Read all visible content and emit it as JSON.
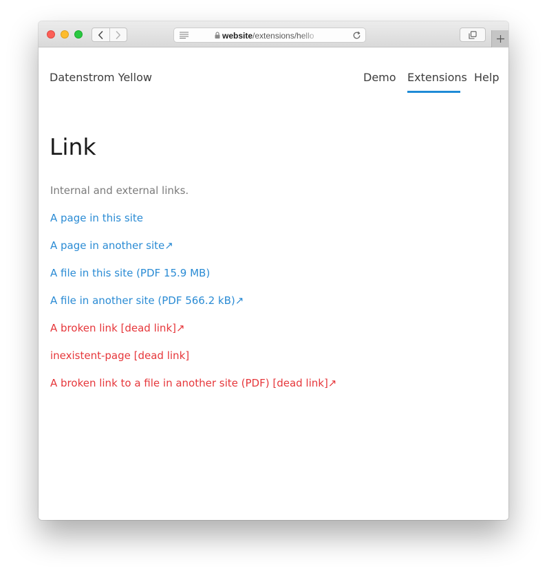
{
  "browser": {
    "url": {
      "host": "website",
      "path": "/extensions/hello"
    }
  },
  "site": {
    "title": "Datenstrom Yellow",
    "nav": [
      {
        "label": "Demo"
      },
      {
        "label": "Extensions",
        "active": true
      },
      {
        "label": "Help"
      }
    ]
  },
  "page": {
    "title": "Link",
    "description": "Internal and external links.",
    "links": [
      {
        "text": "A page in this site",
        "status": "ok"
      },
      {
        "text": "A page in another site↗",
        "status": "ok"
      },
      {
        "text": "A file in this site (PDF 15.9 MB)",
        "status": "ok"
      },
      {
        "text": "A file in another site (PDF 566.2 kB)↗",
        "status": "ok"
      },
      {
        "text": "A broken link [dead link]↗",
        "status": "broken"
      },
      {
        "text": "inexistent-page [dead link]",
        "status": "broken"
      },
      {
        "text": "A broken link to a file in another site (PDF) [dead link]↗",
        "status": "broken"
      }
    ]
  },
  "colors": {
    "accent": "#1e8bd6",
    "link": "#2a8bd4",
    "broken_link": "#e6363a",
    "text": "#3c3c3c",
    "muted": "#7b7b7b"
  },
  "icons": {
    "traffic_lights": [
      "close-light",
      "minimize-light",
      "zoom-light"
    ],
    "toolbar": [
      "back-icon",
      "forward-icon",
      "reader-icon",
      "lock-icon",
      "reload-icon",
      "tabs-overview-icon",
      "new-tab-icon"
    ]
  }
}
